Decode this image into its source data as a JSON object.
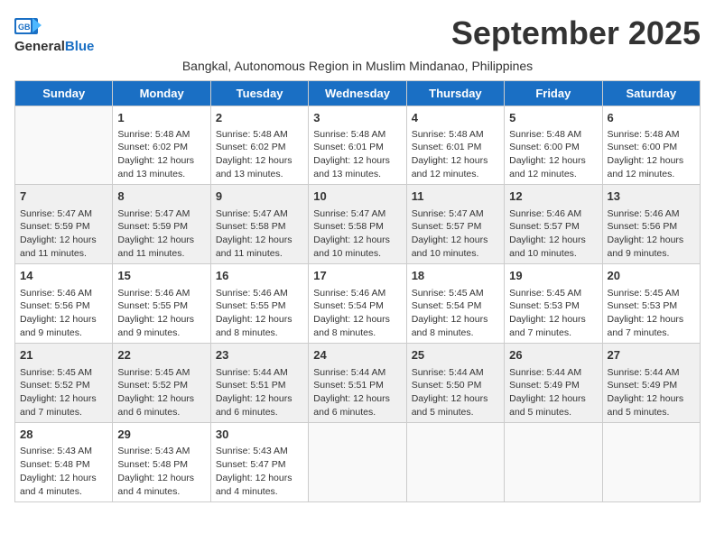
{
  "logo": {
    "general": "General",
    "blue": "Blue"
  },
  "header": {
    "month": "September 2025",
    "subtitle": "Bangkal, Autonomous Region in Muslim Mindanao, Philippines"
  },
  "weekdays": [
    "Sunday",
    "Monday",
    "Tuesday",
    "Wednesday",
    "Thursday",
    "Friday",
    "Saturday"
  ],
  "weeks": [
    [
      {
        "day": "",
        "info": ""
      },
      {
        "day": "1",
        "info": "Sunrise: 5:48 AM\nSunset: 6:02 PM\nDaylight: 12 hours\nand 13 minutes."
      },
      {
        "day": "2",
        "info": "Sunrise: 5:48 AM\nSunset: 6:02 PM\nDaylight: 12 hours\nand 13 minutes."
      },
      {
        "day": "3",
        "info": "Sunrise: 5:48 AM\nSunset: 6:01 PM\nDaylight: 12 hours\nand 13 minutes."
      },
      {
        "day": "4",
        "info": "Sunrise: 5:48 AM\nSunset: 6:01 PM\nDaylight: 12 hours\nand 12 minutes."
      },
      {
        "day": "5",
        "info": "Sunrise: 5:48 AM\nSunset: 6:00 PM\nDaylight: 12 hours\nand 12 minutes."
      },
      {
        "day": "6",
        "info": "Sunrise: 5:48 AM\nSunset: 6:00 PM\nDaylight: 12 hours\nand 12 minutes."
      }
    ],
    [
      {
        "day": "7",
        "info": "Sunrise: 5:47 AM\nSunset: 5:59 PM\nDaylight: 12 hours\nand 11 minutes."
      },
      {
        "day": "8",
        "info": "Sunrise: 5:47 AM\nSunset: 5:59 PM\nDaylight: 12 hours\nand 11 minutes."
      },
      {
        "day": "9",
        "info": "Sunrise: 5:47 AM\nSunset: 5:58 PM\nDaylight: 12 hours\nand 11 minutes."
      },
      {
        "day": "10",
        "info": "Sunrise: 5:47 AM\nSunset: 5:58 PM\nDaylight: 12 hours\nand 10 minutes."
      },
      {
        "day": "11",
        "info": "Sunrise: 5:47 AM\nSunset: 5:57 PM\nDaylight: 12 hours\nand 10 minutes."
      },
      {
        "day": "12",
        "info": "Sunrise: 5:46 AM\nSunset: 5:57 PM\nDaylight: 12 hours\nand 10 minutes."
      },
      {
        "day": "13",
        "info": "Sunrise: 5:46 AM\nSunset: 5:56 PM\nDaylight: 12 hours\nand 9 minutes."
      }
    ],
    [
      {
        "day": "14",
        "info": "Sunrise: 5:46 AM\nSunset: 5:56 PM\nDaylight: 12 hours\nand 9 minutes."
      },
      {
        "day": "15",
        "info": "Sunrise: 5:46 AM\nSunset: 5:55 PM\nDaylight: 12 hours\nand 9 minutes."
      },
      {
        "day": "16",
        "info": "Sunrise: 5:46 AM\nSunset: 5:55 PM\nDaylight: 12 hours\nand 8 minutes."
      },
      {
        "day": "17",
        "info": "Sunrise: 5:46 AM\nSunset: 5:54 PM\nDaylight: 12 hours\nand 8 minutes."
      },
      {
        "day": "18",
        "info": "Sunrise: 5:45 AM\nSunset: 5:54 PM\nDaylight: 12 hours\nand 8 minutes."
      },
      {
        "day": "19",
        "info": "Sunrise: 5:45 AM\nSunset: 5:53 PM\nDaylight: 12 hours\nand 7 minutes."
      },
      {
        "day": "20",
        "info": "Sunrise: 5:45 AM\nSunset: 5:53 PM\nDaylight: 12 hours\nand 7 minutes."
      }
    ],
    [
      {
        "day": "21",
        "info": "Sunrise: 5:45 AM\nSunset: 5:52 PM\nDaylight: 12 hours\nand 7 minutes."
      },
      {
        "day": "22",
        "info": "Sunrise: 5:45 AM\nSunset: 5:52 PM\nDaylight: 12 hours\nand 6 minutes."
      },
      {
        "day": "23",
        "info": "Sunrise: 5:44 AM\nSunset: 5:51 PM\nDaylight: 12 hours\nand 6 minutes."
      },
      {
        "day": "24",
        "info": "Sunrise: 5:44 AM\nSunset: 5:51 PM\nDaylight: 12 hours\nand 6 minutes."
      },
      {
        "day": "25",
        "info": "Sunrise: 5:44 AM\nSunset: 5:50 PM\nDaylight: 12 hours\nand 5 minutes."
      },
      {
        "day": "26",
        "info": "Sunrise: 5:44 AM\nSunset: 5:49 PM\nDaylight: 12 hours\nand 5 minutes."
      },
      {
        "day": "27",
        "info": "Sunrise: 5:44 AM\nSunset: 5:49 PM\nDaylight: 12 hours\nand 5 minutes."
      }
    ],
    [
      {
        "day": "28",
        "info": "Sunrise: 5:43 AM\nSunset: 5:48 PM\nDaylight: 12 hours\nand 4 minutes."
      },
      {
        "day": "29",
        "info": "Sunrise: 5:43 AM\nSunset: 5:48 PM\nDaylight: 12 hours\nand 4 minutes."
      },
      {
        "day": "30",
        "info": "Sunrise: 5:43 AM\nSunset: 5:47 PM\nDaylight: 12 hours\nand 4 minutes."
      },
      {
        "day": "",
        "info": ""
      },
      {
        "day": "",
        "info": ""
      },
      {
        "day": "",
        "info": ""
      },
      {
        "day": "",
        "info": ""
      }
    ]
  ]
}
